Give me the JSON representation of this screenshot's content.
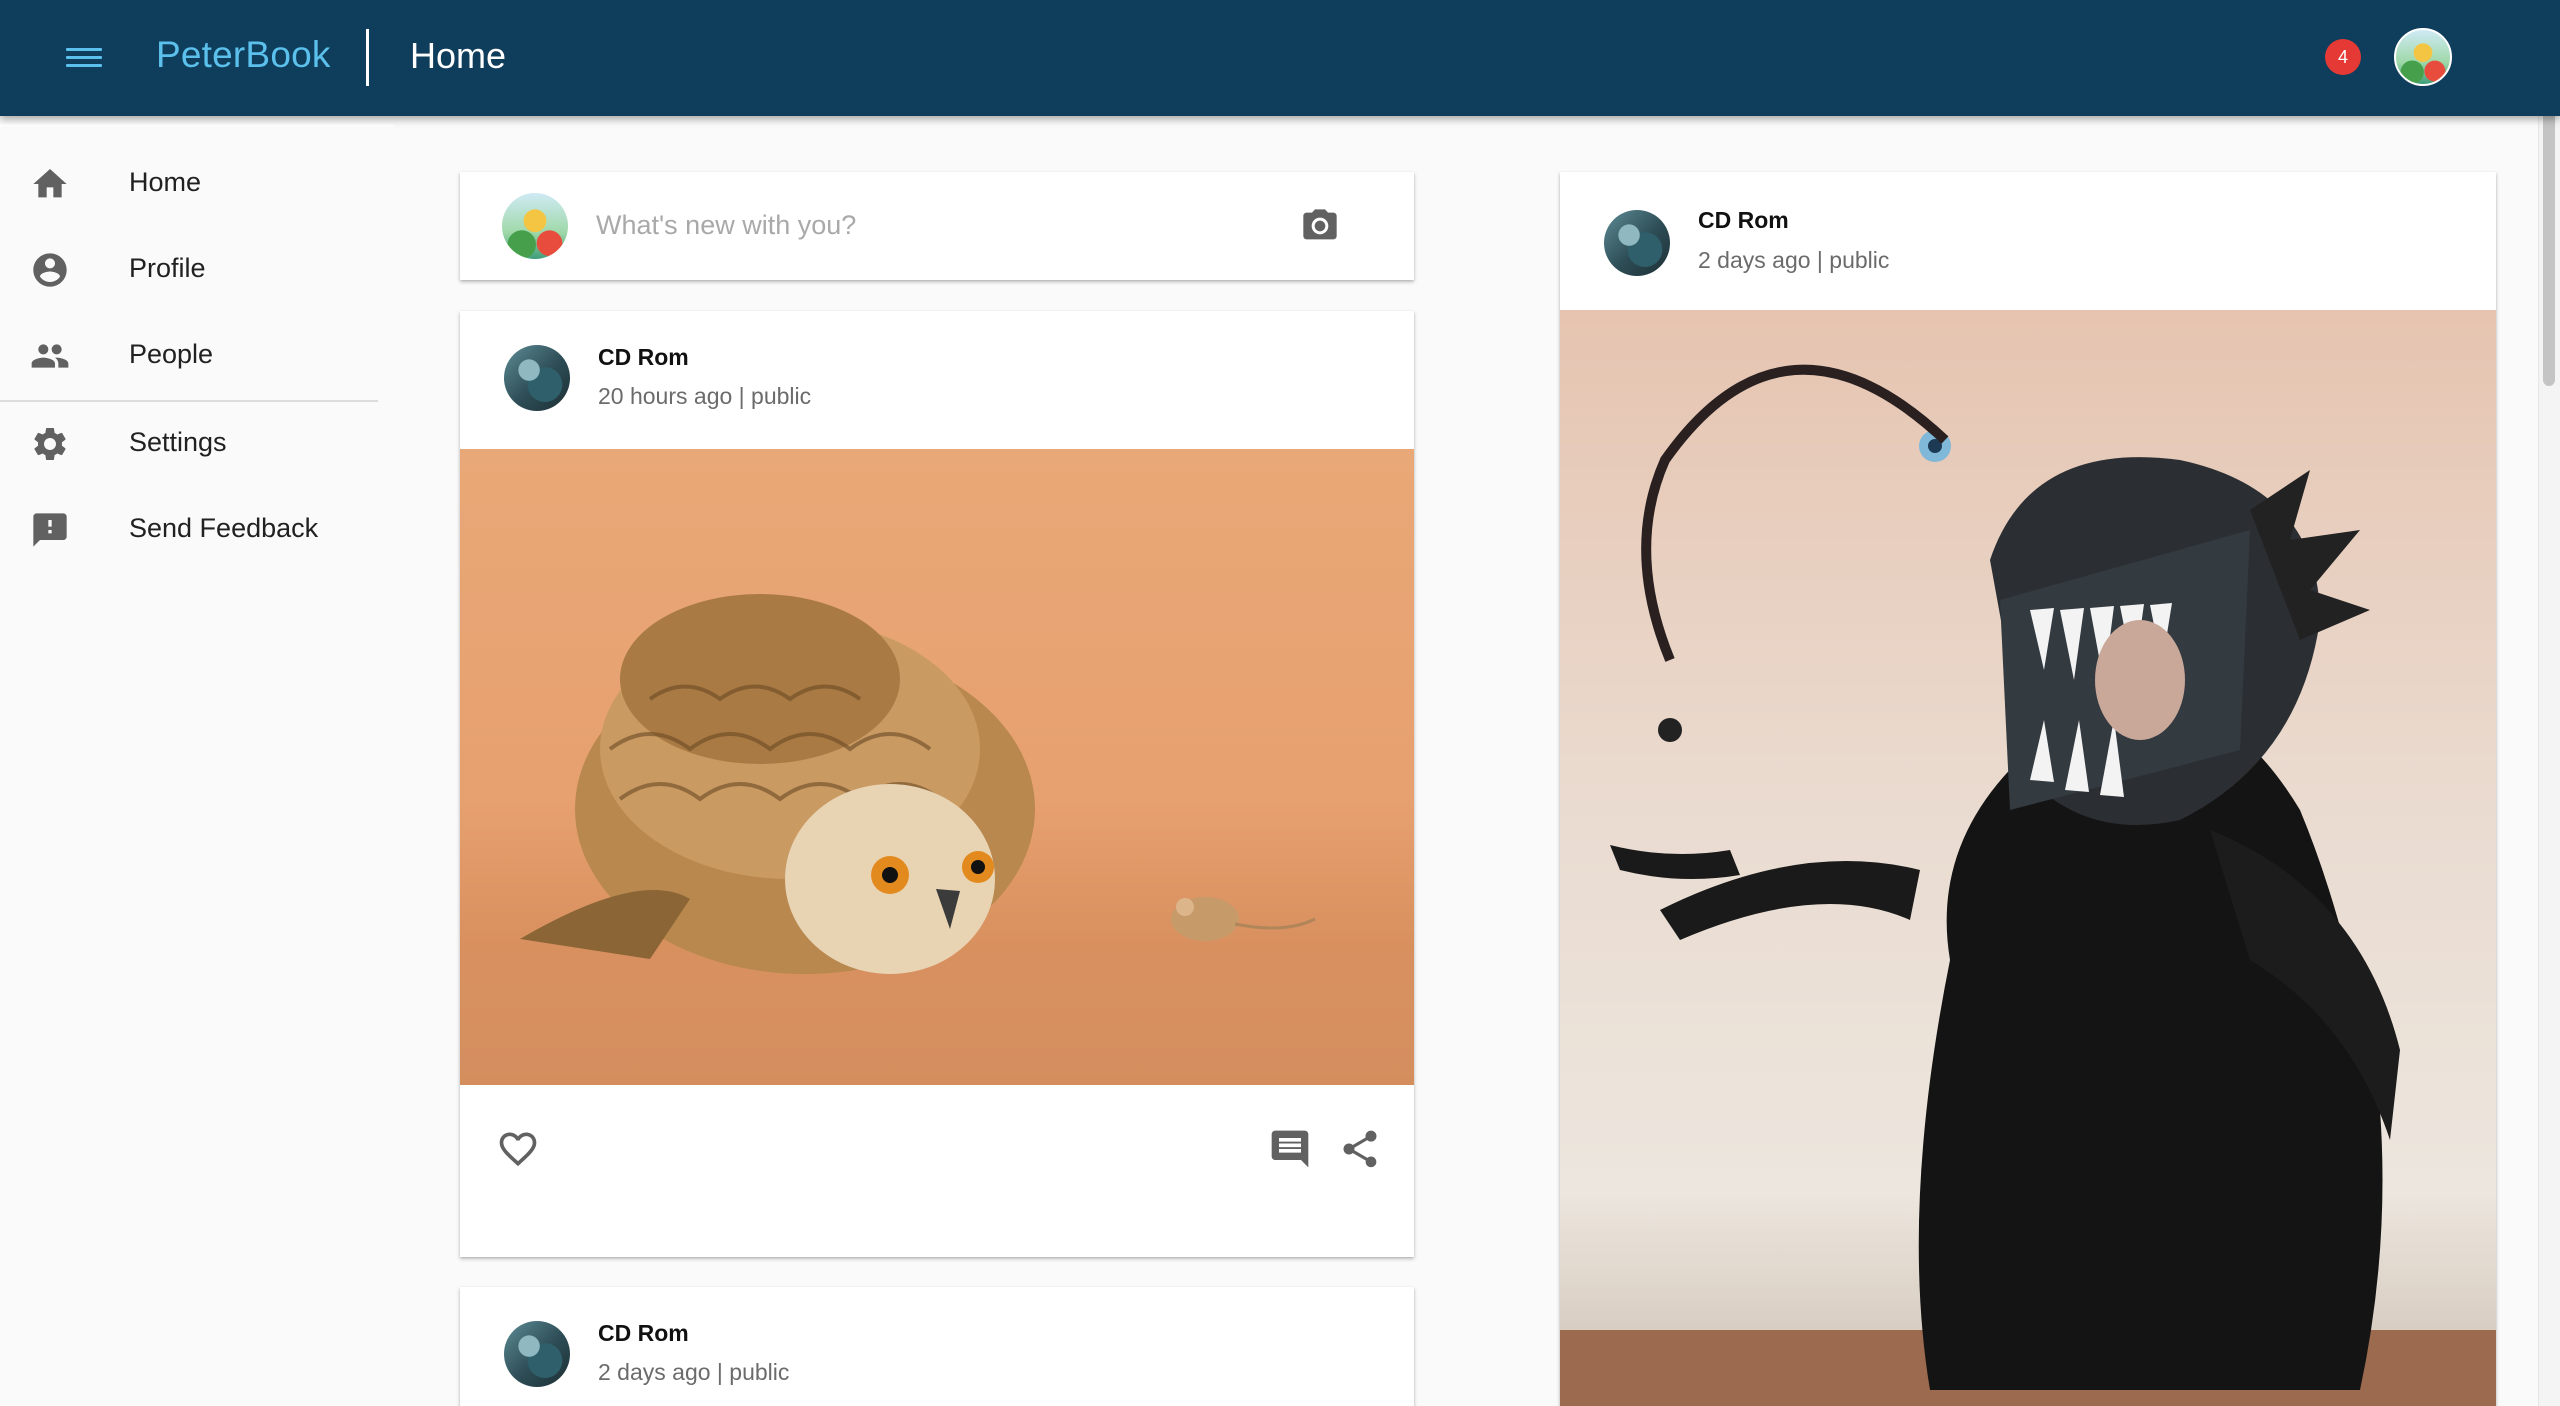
{
  "header": {
    "brand": "PeterBook",
    "title": "Home",
    "notification_count": "4",
    "colors": {
      "bar": "#0f3d5c",
      "brand": "#5bc0eb",
      "badge": "#e53935"
    }
  },
  "sidebar": {
    "items": [
      {
        "label": "Home",
        "icon": "home-icon"
      },
      {
        "label": "Profile",
        "icon": "account-circle-icon"
      },
      {
        "label": "People",
        "icon": "people-icon"
      },
      {
        "label": "Settings",
        "icon": "gear-icon"
      },
      {
        "label": "Send Feedback",
        "icon": "feedback-icon"
      }
    ]
  },
  "composer": {
    "placeholder": "What's new with you?",
    "icon": "camera-icon"
  },
  "posts": [
    {
      "author": "CD Rom",
      "meta": "20 hours ago | public",
      "image": "owl-and-mouse-photo",
      "actions": [
        "heart-icon",
        "comment-icon",
        "share-icon"
      ]
    },
    {
      "author": "CD Rom",
      "meta": "2 days ago | public",
      "image": "anglerfish-costume-photo"
    },
    {
      "author": "CD Rom",
      "meta": "2 days ago | public"
    }
  ]
}
